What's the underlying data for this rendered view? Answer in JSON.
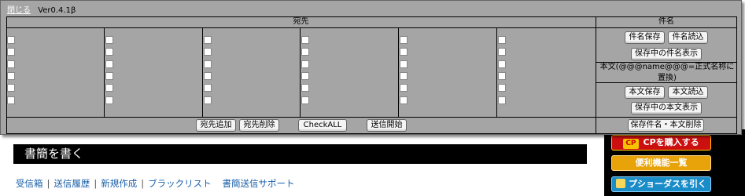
{
  "overlay": {
    "close_label": "閉じる",
    "version": "Ver0.4.1β",
    "recipients_header": "宛先",
    "subject_header": "件名",
    "subject_buttons": {
      "save": "件名保存",
      "load": "件名読込",
      "show": "保存中の件名表示"
    },
    "body_note": "本文(@@@name@@@=正式名称に置換)",
    "body_buttons": {
      "save": "本文保存",
      "load": "本文読込",
      "show": "保存中の本文表示"
    },
    "bottom_buttons": {
      "add": "宛先追加",
      "delete": "宛先削除",
      "check_all": "CheckALL",
      "send": "送信開始"
    },
    "delete_saved": "保存件名・本文削除"
  },
  "page": {
    "heading": "書簡を書く",
    "nav": [
      "受信箱",
      "送信履歴",
      "新規作成",
      "ブラックリスト",
      "書簡送信サポート"
    ]
  },
  "sidebar": {
    "buy_cp": "CPを購入する",
    "cp_badge": "CP",
    "features": "便利機能一覧",
    "gacha": "プショーダスを引く"
  }
}
